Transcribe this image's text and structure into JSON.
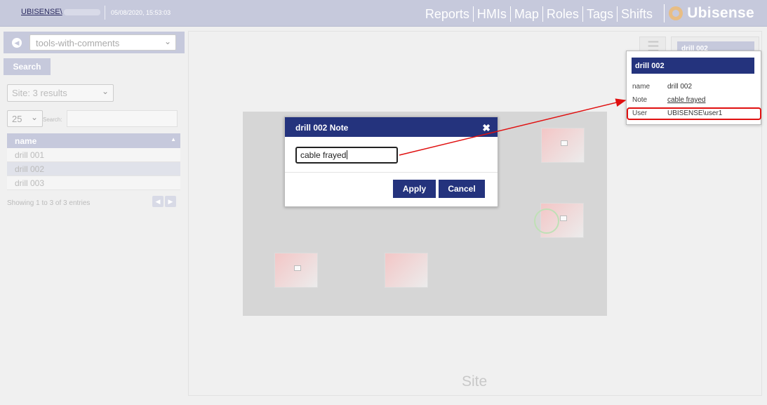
{
  "header": {
    "user": "UBISENSE\\",
    "datetime": "05/08/2020, 15:53:03",
    "nav": [
      "Reports",
      "HMIs",
      "Map",
      "Roles",
      "Tags",
      "Shifts"
    ],
    "brand": "Ubisense"
  },
  "sidebar": {
    "filter_value": "tools-with-comments",
    "search_label": "Search",
    "site_select": "Site: 3 results",
    "page_length": "25",
    "search_field_label": "Search:",
    "table_header": "name",
    "rows": [
      "drill 001",
      "drill 002",
      "drill 003"
    ],
    "showing": "Showing 1 to 3 of 3 entries"
  },
  "map": {
    "label": "Site"
  },
  "side_card": {
    "title": "drill 002"
  },
  "dialog": {
    "title": "drill 002 Note",
    "input_value": "cable frayed",
    "apply": "Apply",
    "cancel": "Cancel"
  },
  "popup": {
    "title": "drill 002",
    "properties": [
      {
        "label": "name",
        "value": "drill 002"
      },
      {
        "label": "Note",
        "value": "cable frayed"
      },
      {
        "label": "User",
        "value": "UBISENSE\\user1"
      }
    ]
  },
  "colors": {
    "header_bg": "#c6c9dc",
    "accent": "#24337d",
    "annotation": "#e01010"
  }
}
